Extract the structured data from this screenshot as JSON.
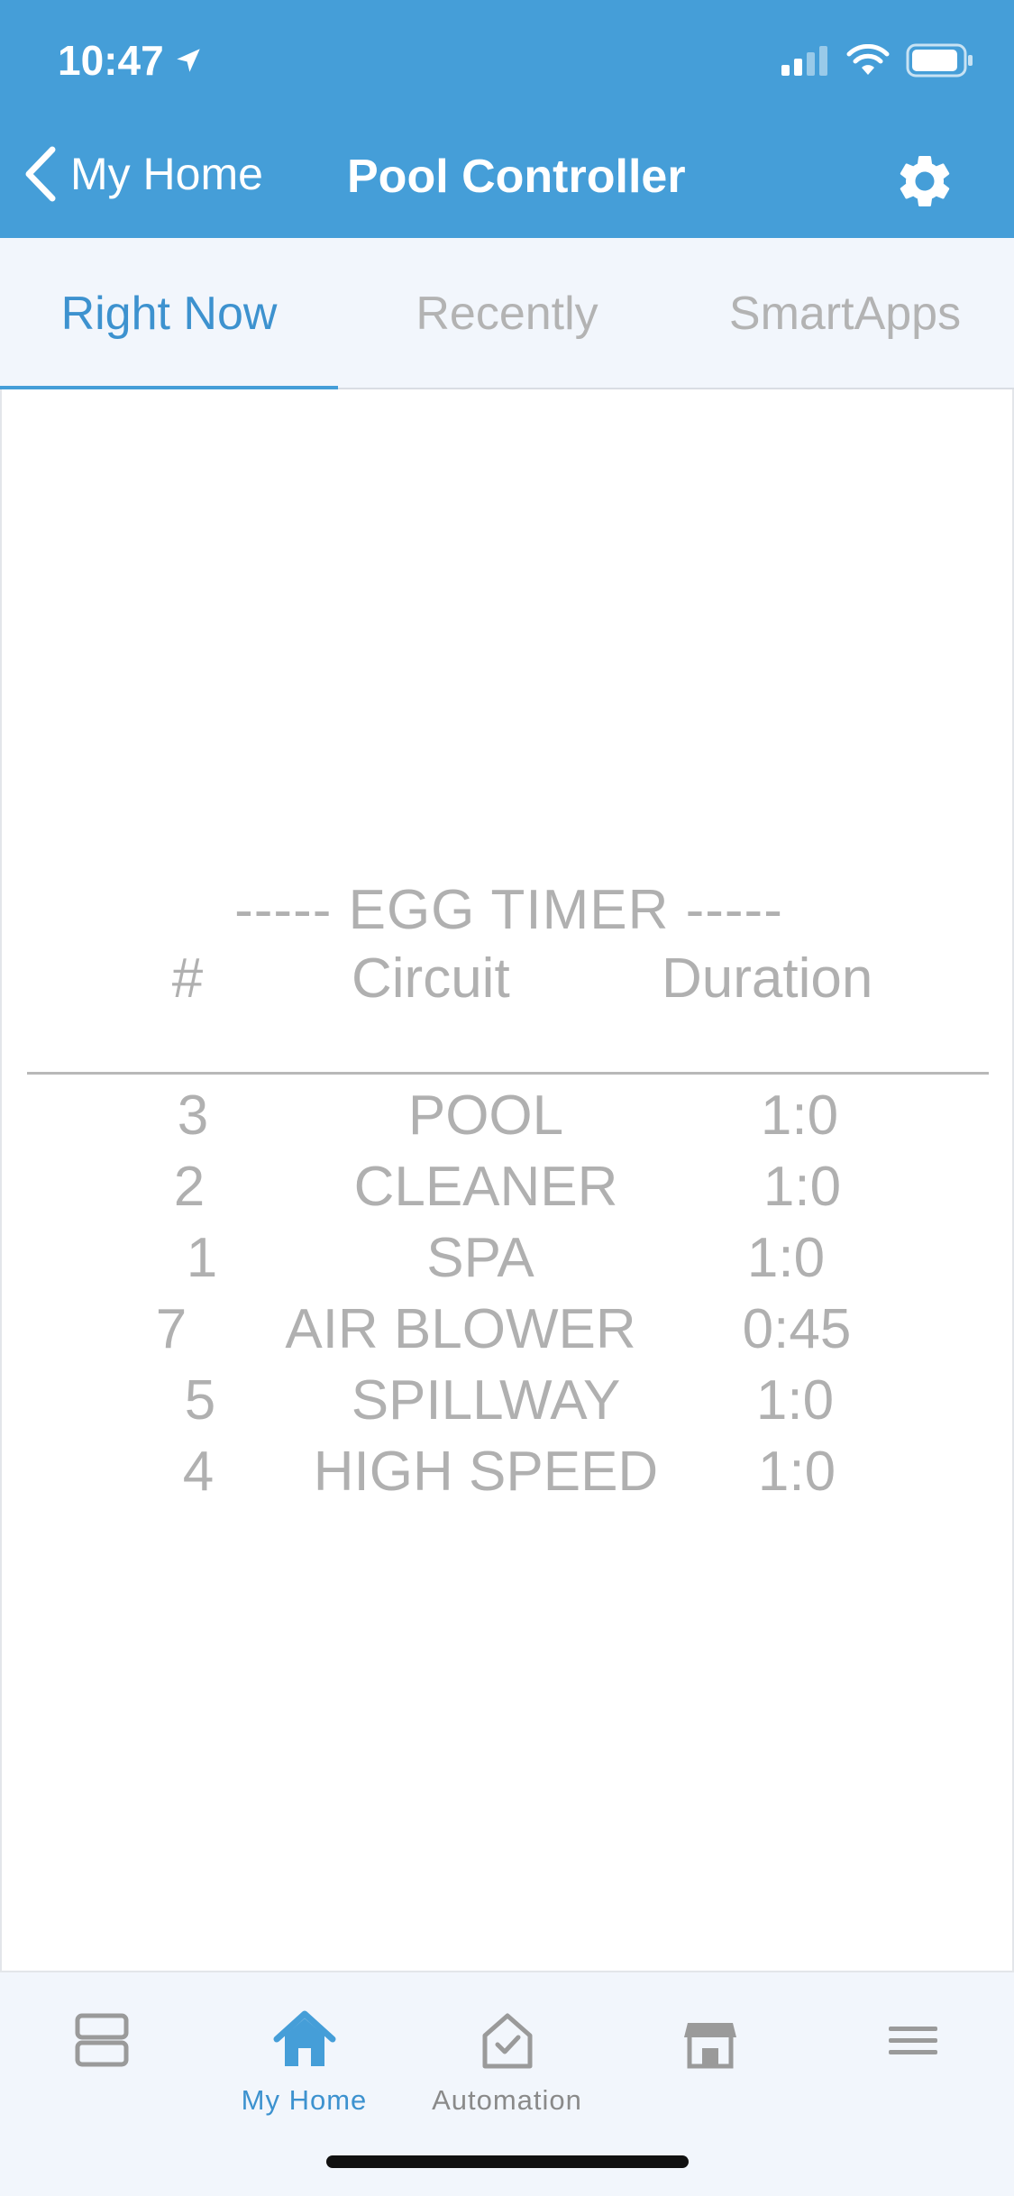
{
  "status_bar": {
    "time": "10:47"
  },
  "header": {
    "back_label": "My Home",
    "title": "Pool Controller"
  },
  "tabs": [
    {
      "label": "Right Now",
      "active": true
    },
    {
      "label": "Recently",
      "active": false
    },
    {
      "label": "SmartApps",
      "active": false
    }
  ],
  "egg_timer": {
    "title": "----- EGG TIMER -----",
    "headers": {
      "num": "#",
      "circuit": "Circuit",
      "duration": "Duration"
    },
    "rows": [
      {
        "num": "3",
        "circuit": "POOL",
        "duration": "1:0"
      },
      {
        "num": "2",
        "circuit": "CLEANER",
        "duration": "1:0"
      },
      {
        "num": "1",
        "circuit": "SPA",
        "duration": "1:0"
      },
      {
        "num": "7",
        "circuit": "AIR BLOWER",
        "duration": "0:45"
      },
      {
        "num": "5",
        "circuit": "SPILLWAY",
        "duration": "1:0"
      },
      {
        "num": "4",
        "circuit": "HIGH SPEED",
        "duration": "1:0"
      }
    ]
  },
  "bottom_nav": [
    {
      "label": "",
      "icon": "dashboard-icon"
    },
    {
      "label": "My Home",
      "icon": "home-icon",
      "active": true
    },
    {
      "label": "Automation",
      "icon": "automation-icon"
    },
    {
      "label": "",
      "icon": "marketplace-icon"
    },
    {
      "label": "",
      "icon": "menu-icon"
    }
  ],
  "colors": {
    "header_bg": "#459ed8",
    "accent": "#3d92cf",
    "muted_text": "#b0b0b0"
  }
}
